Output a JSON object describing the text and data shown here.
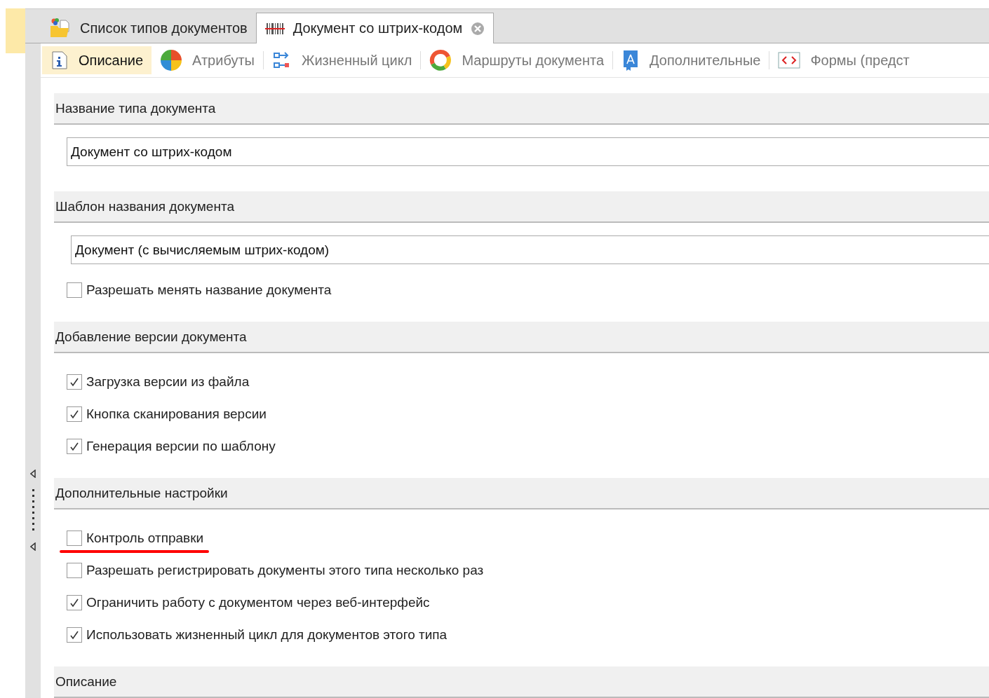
{
  "doc_tabs": [
    {
      "label": "Список типов документов",
      "selected": false,
      "closable": false
    },
    {
      "label": "Документ со штрих-кодом",
      "selected": true,
      "closable": true
    }
  ],
  "toolbar": [
    {
      "label": "Описание",
      "selected": true
    },
    {
      "label": "Атрибуты",
      "selected": false
    },
    {
      "label": "Жизненный цикл",
      "selected": false
    },
    {
      "label": "Маршруты документа",
      "selected": false
    },
    {
      "label": "Дополнительные",
      "selected": false
    },
    {
      "label": "Формы (предст",
      "selected": false
    }
  ],
  "sections": [
    {
      "title": "Название типа документа",
      "items": [
        {
          "kind": "field",
          "value": "Документ со штрих-кодом"
        }
      ]
    },
    {
      "title": "Шаблон названия документа",
      "items": [
        {
          "kind": "field",
          "value": "Документ (с вычисляемым штрих-кодом)"
        },
        {
          "kind": "checkbox",
          "label": "Разрешать менять название документа",
          "checked": false,
          "underlined": false
        }
      ]
    },
    {
      "title": "Добавление версии документа",
      "items": [
        {
          "kind": "checkbox",
          "label": "Загрузка версии из файла",
          "checked": true,
          "underlined": false
        },
        {
          "kind": "checkbox",
          "label": "Кнопка сканирования версии",
          "checked": true,
          "underlined": false
        },
        {
          "kind": "checkbox",
          "label": "Генерация версии по шаблону",
          "checked": true,
          "underlined": false
        }
      ]
    },
    {
      "title": "Дополнительные настройки",
      "items": [
        {
          "kind": "checkbox",
          "label": "Контроль отправки",
          "checked": false,
          "underlined": true
        },
        {
          "kind": "checkbox",
          "label": "Разрешать регистрировать документы этого типа несколько раз",
          "checked": false,
          "underlined": false
        },
        {
          "kind": "checkbox",
          "label": "Ограничить работу с документом через веб-интерфейс",
          "checked": true,
          "underlined": false
        },
        {
          "kind": "checkbox",
          "label": "Использовать жизненный цикл для документов этого типа",
          "checked": true,
          "underlined": false
        }
      ]
    },
    {
      "title": "Описание"
    }
  ]
}
